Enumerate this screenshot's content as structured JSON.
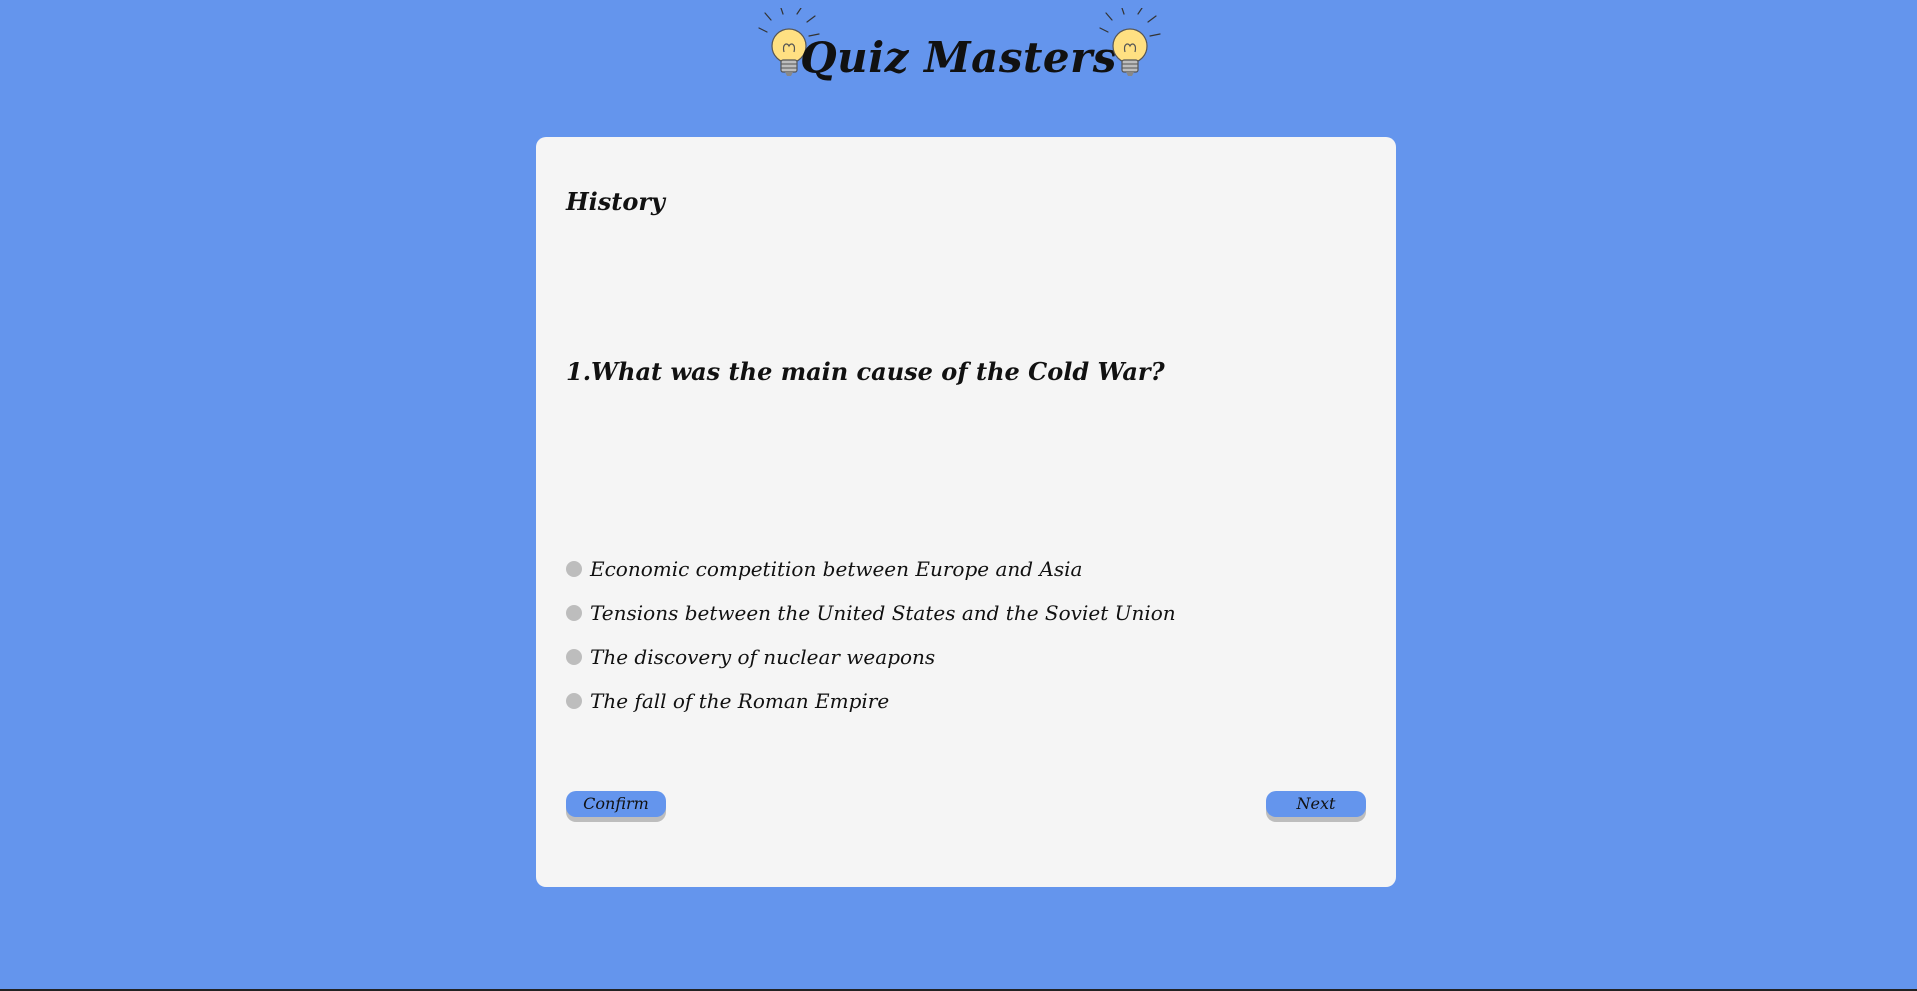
{
  "header": {
    "title": "Quiz Masters",
    "left_icon": "lightbulb-icon",
    "right_icon": "lightbulb-icon"
  },
  "quiz": {
    "category": "History",
    "question": "1.What was the main cause of the Cold War?",
    "answers": [
      {
        "label": "Economic competition between Europe and Asia",
        "selected": false
      },
      {
        "label": "Tensions between the United States and the Soviet Union",
        "selected": false
      },
      {
        "label": "The discovery of nuclear weapons",
        "selected": false
      },
      {
        "label": "The fall of the Roman Empire",
        "selected": false
      }
    ],
    "confirm_label": "Confirm",
    "next_label": "Next"
  },
  "colors": {
    "background": "#6495ED",
    "card": "#F5F5F5",
    "button": "#6495ED",
    "button_shadow": "#BDBDBD",
    "radio": "#BDBDBD",
    "bulb": "#FFE082"
  }
}
